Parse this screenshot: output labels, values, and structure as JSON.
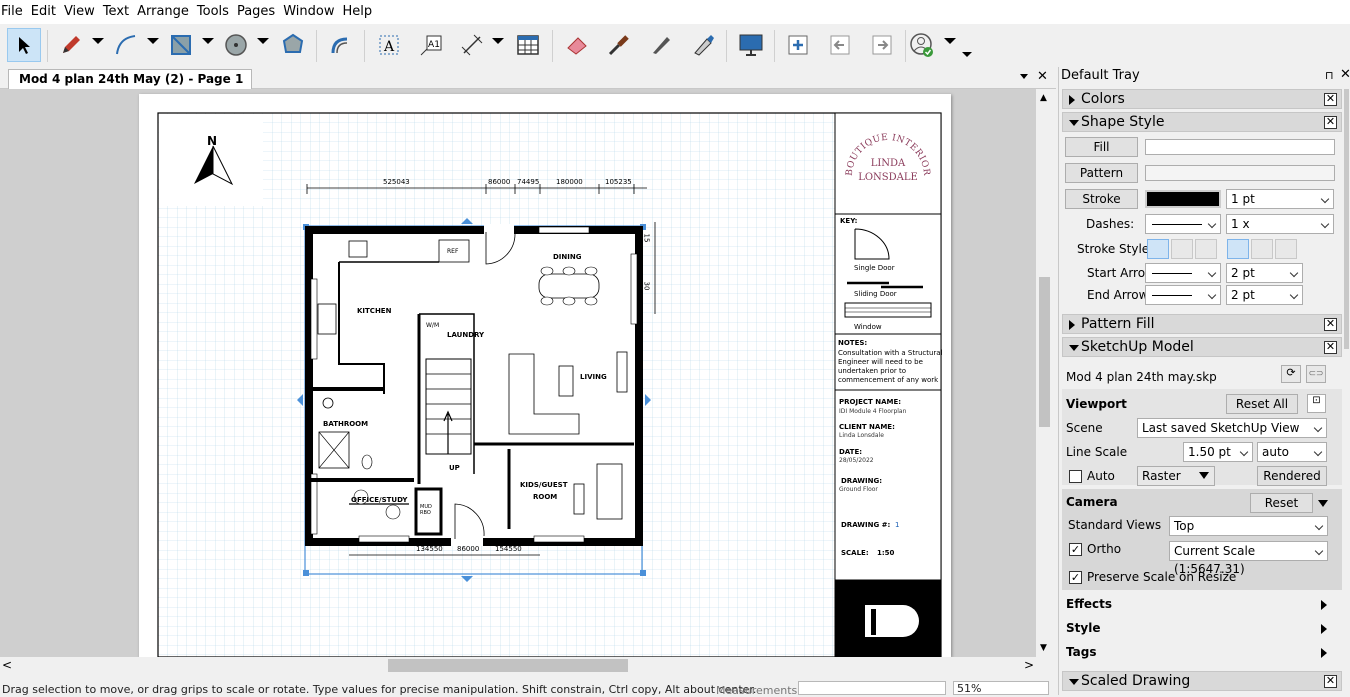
{
  "menu": [
    "File",
    "Edit",
    "View",
    "Text",
    "Arrange",
    "Tools",
    "Pages",
    "Window",
    "Help"
  ],
  "toolbar_icons": [
    "select-icon",
    "pencil-icon",
    "arc-icon",
    "rectangle-icon",
    "circle-icon",
    "polygon-icon",
    "offset-icon",
    "text-icon",
    "label-icon",
    "dimension-icon",
    "table-icon",
    "eraser-icon",
    "eyedropper-icon",
    "split-icon",
    "join-icon",
    "presentation-icon",
    "add-page-icon",
    "previous-page-icon",
    "next-page-icon",
    "account-icon"
  ],
  "document_tab": {
    "title": "Mod 4 plan 24th May (2) - Page 1"
  },
  "status": {
    "hint": "Drag selection to move, or drag grips to scale or rotate. Type values for precise manipulation. Shift constrain, Ctrl copy, Alt about center.",
    "measurements_label": "Measurements",
    "measurements_value": "",
    "zoom": "51%"
  },
  "tray": {
    "title": "Default Tray",
    "panels": {
      "colors": "Colors",
      "shape_style": "Shape Style",
      "pattern_fill": "Pattern Fill",
      "sketchup_model": "SketchUp Model",
      "scaled_drawing": "Scaled Drawing"
    },
    "shape_style": {
      "fill": "Fill",
      "pattern": "Pattern",
      "stroke": "Stroke",
      "stroke_width": "1 pt",
      "dashes_label": "Dashes:",
      "dash_scale": "1 x",
      "stroke_style_label": "Stroke Style:",
      "start_arrow_label": "Start Arrow:",
      "start_arrow_size": "2 pt",
      "end_arrow_label": "End Arrow:",
      "end_arrow_size": "2 pt",
      "stroke_color": "#000000"
    },
    "sketchup_model": {
      "file": "Mod 4 plan 24th may.skp",
      "viewport_label": "Viewport",
      "reset_all": "Reset All",
      "scene_label": "Scene",
      "scene_value": "Last saved SketchUp View",
      "line_scale_label": "Line Scale",
      "line_scale_value": "1.50 pt",
      "line_scale_mode": "auto",
      "auto_label": "Auto",
      "render_mode": "Raster",
      "rendered": "Rendered",
      "camera_label": "Camera",
      "camera_reset": "Reset",
      "standard_views_label": "Standard Views",
      "standard_views_value": "Top",
      "ortho_label": "Ortho",
      "scale_value": "Current Scale (1:5647.31)",
      "preserve_scale_label": "Preserve Scale on Resize",
      "effects": "Effects",
      "style": "Style",
      "tags": "Tags"
    }
  },
  "drawing": {
    "north": "N",
    "dims_top": [
      "525043",
      "86000",
      "74495",
      "180000",
      "105235"
    ],
    "dims_bottom": [
      "134550",
      "86000",
      "154550"
    ],
    "dims_right": [
      "15",
      "30"
    ],
    "rooms": [
      "KITCHEN",
      "DINING",
      "LAUNDRY",
      "LIVING",
      "BATHROOM",
      "OFFICE/STUDY",
      "KIDS/GUEST",
      "ROOM",
      "UP",
      "REF",
      "W/M",
      "MUD",
      "RBO"
    ],
    "logo_lines": [
      "BOUTIQUE INTERIOR DESIGNS",
      "LINDA",
      "LONSDALE"
    ],
    "key_title": "KEY:",
    "key_items": [
      "Single Door",
      "Sliding Door",
      "Window"
    ],
    "notes_title": "NOTES:",
    "notes_lines": [
      "Consultation with a Structural",
      "Engineer will need to be",
      "undertaken prior to",
      "commencement of any work"
    ],
    "project_label": "PROJECT NAME:",
    "project_value": "IDI Module 4 Floorplan",
    "client_label": "CLIENT NAME:",
    "client_value": "Linda Lonsdale",
    "date_label": "DATE:",
    "date_value": "28/05/2022",
    "drawing_label": "DRAWING:",
    "drawing_value": "Ground Floor",
    "drawing_num_label": "DRAWING #:",
    "drawing_num_value": "1",
    "scale_label": "SCALE:",
    "scale_value": "1:50"
  }
}
